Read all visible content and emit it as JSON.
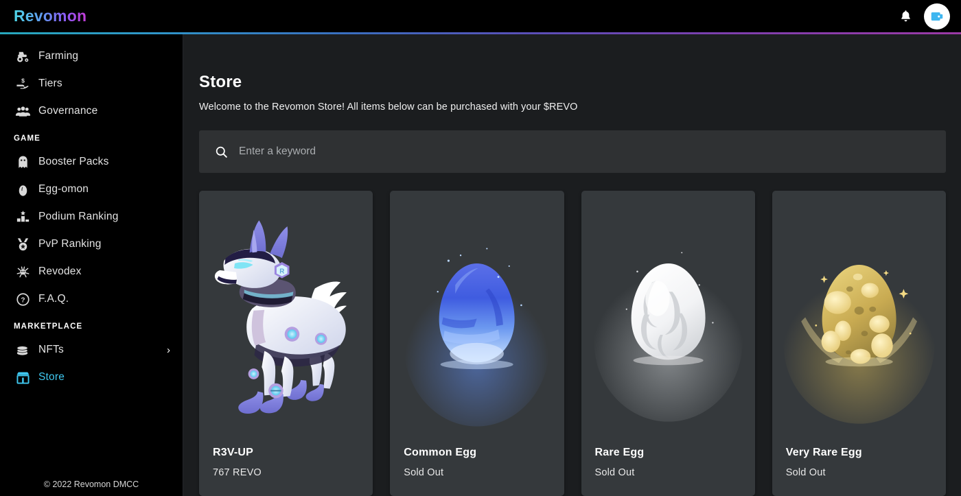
{
  "topbar": {
    "logo": "Revomon",
    "notification_icon": "bell-icon",
    "avatar_icon": "wallet-icon",
    "accent_start": "#4fd7e8",
    "accent_end": "#c23bd6"
  },
  "sidebar": {
    "items": [
      {
        "label": "Farming",
        "icon": "tractor-icon",
        "active": false
      },
      {
        "label": "Tiers",
        "icon": "hand-coin-icon",
        "active": false
      },
      {
        "label": "Governance",
        "icon": "people-icon",
        "active": false
      }
    ],
    "sections": [
      {
        "title": "GAME",
        "items": [
          {
            "label": "Booster Packs",
            "icon": "ghost-icon",
            "active": false
          },
          {
            "label": "Egg-omon",
            "icon": "egg-icon",
            "active": false
          },
          {
            "label": "Podium Ranking",
            "icon": "podium-icon",
            "active": false
          },
          {
            "label": "PvP Ranking",
            "icon": "medal-icon",
            "active": false
          },
          {
            "label": "Revodex",
            "icon": "creature-icon",
            "active": false
          },
          {
            "label": "F.A.Q.",
            "icon": "question-icon",
            "active": false
          }
        ]
      },
      {
        "title": "MARKETPLACE",
        "items": [
          {
            "label": "NFTs",
            "icon": "coins-icon",
            "active": false,
            "chevron": "›"
          },
          {
            "label": "Store",
            "icon": "store-icon",
            "active": true
          }
        ]
      }
    ],
    "footer": "© 2022 Revomon DMCC",
    "active_color": "#3fc7ef"
  },
  "main": {
    "title": "Store",
    "subtitle": "Welcome to the Revomon Store! All items below can be purchased with your $REVO",
    "search": {
      "placeholder": "Enter a keyword",
      "value": "",
      "icon": "search-icon"
    },
    "products": [
      {
        "name": "R3V-UP",
        "price": "767 REVO",
        "art": "robot-wolf"
      },
      {
        "name": "Common Egg",
        "price": "Sold Out",
        "art": "blue-egg"
      },
      {
        "name": "Rare Egg",
        "price": "Sold Out",
        "art": "white-egg"
      },
      {
        "name": "Very Rare Egg",
        "price": "Sold Out",
        "art": "gold-egg"
      }
    ]
  }
}
